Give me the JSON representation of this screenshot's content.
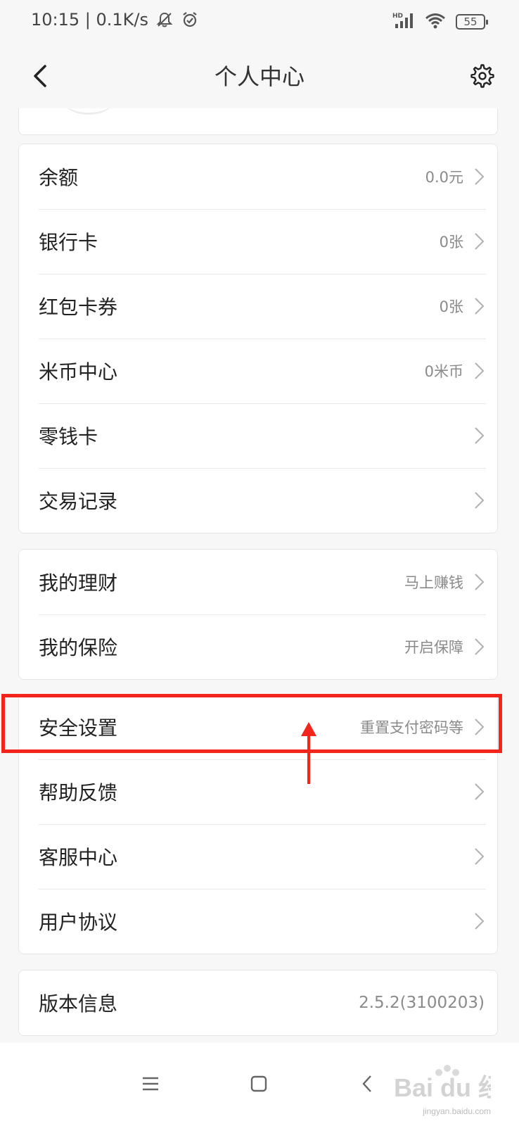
{
  "status_bar": {
    "time_speed": "10:15 | 0.1K/s",
    "battery": "55",
    "network": "HD",
    "icons": [
      "mute-bell-icon",
      "alarm-icon",
      "signal-icon",
      "wifi-icon",
      "battery-icon"
    ]
  },
  "header": {
    "title": "个人中心",
    "back_icon": "back-arrow-icon",
    "settings_icon": "gear-icon"
  },
  "sections": [
    {
      "items": [
        {
          "label": "余额",
          "value": "0.0元",
          "chevron": true
        },
        {
          "label": "银行卡",
          "value": "0张",
          "chevron": true
        },
        {
          "label": "红包卡券",
          "value": "0张",
          "chevron": true
        },
        {
          "label": "米币中心",
          "value": "0米币",
          "chevron": true
        },
        {
          "label": "零钱卡",
          "value": "",
          "chevron": true
        },
        {
          "label": "交易记录",
          "value": "",
          "chevron": true
        }
      ]
    },
    {
      "items": [
        {
          "label": "我的理财",
          "value": "马上赚钱",
          "chevron": true
        },
        {
          "label": "我的保险",
          "value": "开启保障",
          "chevron": true
        }
      ]
    },
    {
      "items": [
        {
          "label": "安全设置",
          "value": "重置支付密码等",
          "chevron": true
        },
        {
          "label": "帮助反馈",
          "value": "",
          "chevron": true
        },
        {
          "label": "客服中心",
          "value": "",
          "chevron": true
        },
        {
          "label": "用户协议",
          "value": "",
          "chevron": true
        }
      ]
    },
    {
      "items": [
        {
          "label": "版本信息",
          "value": "2.5.2(3100203)",
          "chevron": false
        }
      ]
    }
  ],
  "annotation": {
    "highlight_color": "#f3241b",
    "target": "安全设置"
  },
  "bottom_nav": {
    "icons": [
      "menu-icon",
      "home-square-icon",
      "back-chevron-icon"
    ]
  },
  "watermark": {
    "brand": "Bai du 经验",
    "url": "jingyan.baidu.com"
  },
  "colors": {
    "background": "#f7f7f7",
    "card": "#ffffff",
    "text_primary": "#222222",
    "text_secondary": "#8a8a8a"
  }
}
